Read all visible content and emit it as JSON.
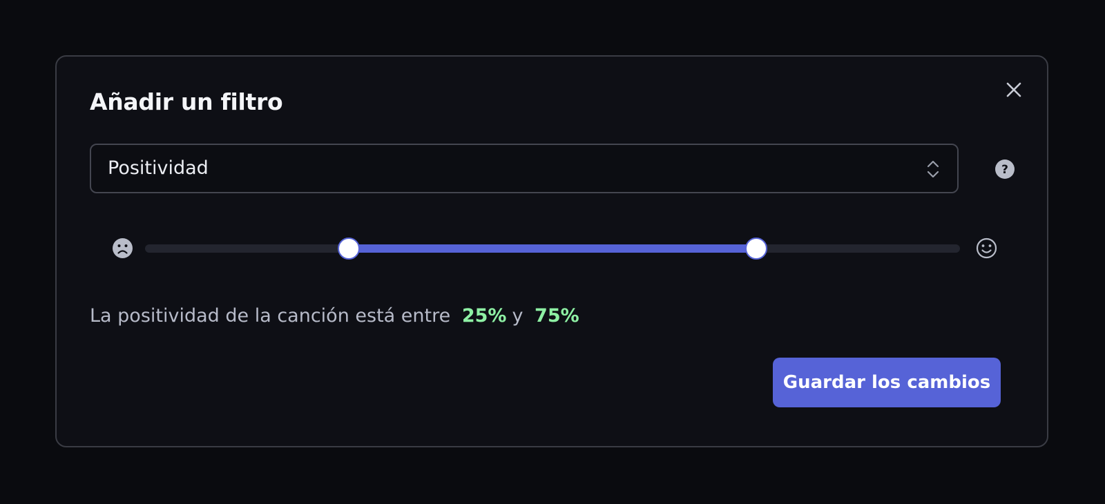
{
  "dialog": {
    "title": "Añadir un filtro",
    "close_icon": "close-icon"
  },
  "select": {
    "value": "Positividad",
    "arrows_icon": "chevron-up-down-icon"
  },
  "help": {
    "icon": "question-circle-icon"
  },
  "slider": {
    "min_icon": "sad-face-icon",
    "max_icon": "happy-face-icon",
    "low_value": 25,
    "high_value": 75
  },
  "summary": {
    "text": "La positividad de la canción está entre",
    "low": "25%",
    "connector": "y",
    "high": "75%"
  },
  "save_button": {
    "label": "Guardar los cambios"
  },
  "colors": {
    "accent": "#5663d7",
    "value_green": "#8ef0a4",
    "background": "#0a0b0f",
    "panel": "#0e0f15"
  }
}
